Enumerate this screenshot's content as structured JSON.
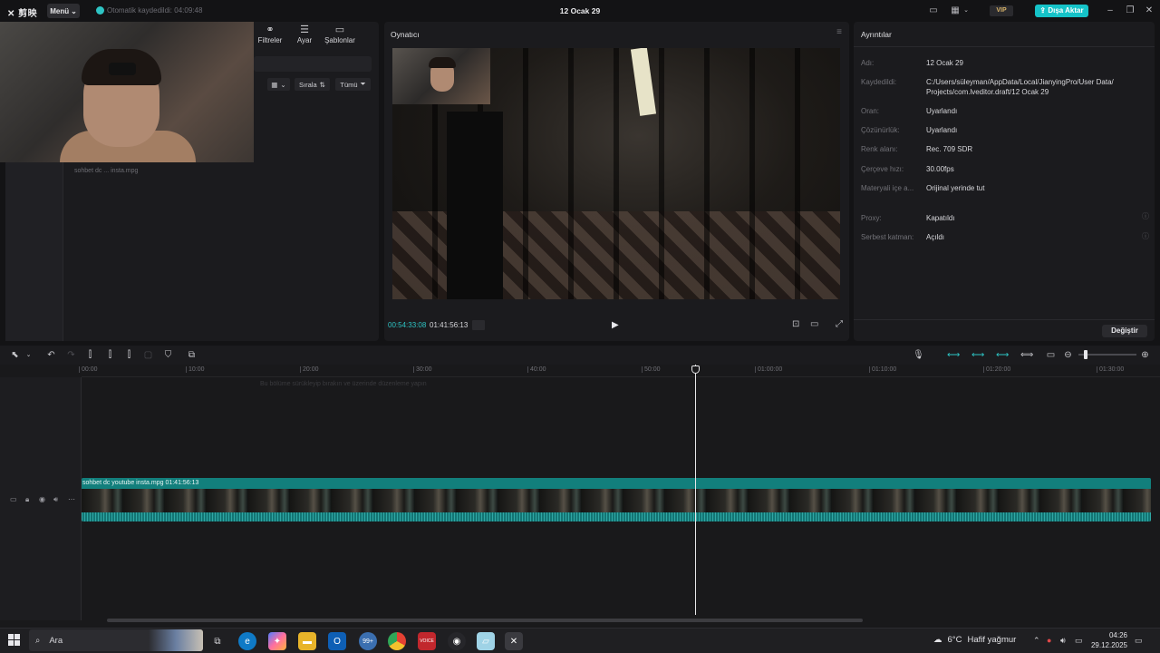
{
  "titlebar": {
    "logo": "剪映",
    "menu_label": "Menü",
    "autosave_text": "Otomatik kaydedildi: 04:09:48",
    "project_title": "12 Ocak 29",
    "vip_label": "VIP",
    "export_label": "Dışa Aktar"
  },
  "media": {
    "tabs": [
      {
        "label": "Filtreler",
        "icon": "filters-icon"
      },
      {
        "label": "Ayar",
        "icon": "adjust-icon"
      },
      {
        "label": "Şablonlar",
        "icon": "templates-icon"
      }
    ],
    "sort_label": "Sırala",
    "filter_label": "Tümü",
    "clip_name": "sohbet dc ... insta.mpg"
  },
  "player": {
    "title": "Oynatıcı",
    "current_time": "00:54:33:08",
    "total_time": "01:41:56:13"
  },
  "details": {
    "title": "Ayrıntılar",
    "rows": [
      {
        "label": "Adı:",
        "value": "12 Ocak 29"
      },
      {
        "label": "Kaydedildi:",
        "value": "C:/Users/süleyman/AppData/Local/JianyingPro/User Data/ Projects/com.lveditor.draft/12 Ocak 29"
      },
      {
        "label": "Oran:",
        "value": "Uyarlandı"
      },
      {
        "label": "Çözünürlük:",
        "value": "Uyarlandı"
      },
      {
        "label": "Renk alanı:",
        "value": "Rec. 709 SDR"
      },
      {
        "label": "Çerçeve hızı:",
        "value": "30.00fps"
      },
      {
        "label": "Materyali içe a...",
        "value": "Orijinal yerinde tut"
      },
      {
        "label": "Proxy:",
        "value": "Kapatıldı"
      },
      {
        "label": "Serbest katman:",
        "value": "Açıldı"
      }
    ],
    "change_label": "Değiştir"
  },
  "timeline": {
    "ruler_ticks": [
      "00:00",
      "10:00",
      "20:00",
      "30:00",
      "40:00",
      "50:00",
      "01:00:00",
      "01:10:00",
      "01:20:00",
      "01:30:00"
    ],
    "hint_text": "Bu bölüme sürükleyip bırakın ve üzerinde düzenleme yapın",
    "clip_label": "sohbet dc youtube insta.mpg  01:41:56:13"
  },
  "taskbar": {
    "search_label": "Ara",
    "mail_badge": "99+",
    "weather_temp": "6°C",
    "weather_text": "Hafif yağmur",
    "time": "04:26",
    "date": "29.12.2025"
  },
  "colors": {
    "accent": "#15c3c8",
    "clip": "#0f6d6c",
    "background": "#131315"
  }
}
